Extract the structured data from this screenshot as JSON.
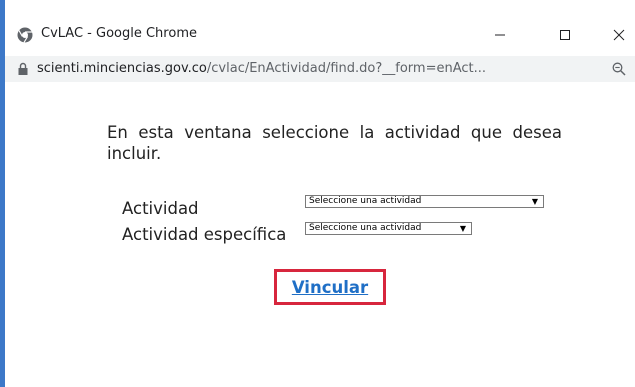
{
  "window": {
    "title": "CvLAC - Google Chrome",
    "minimize_label": "—",
    "maximize_label": "☐",
    "close_label": "✕",
    "accent_color": "#3c78c8"
  },
  "address": {
    "host": "scienti.minciencias.gov.co",
    "path": "/cvlac/EnActividad/find.do?__form=enAct..."
  },
  "page": {
    "intro_text": "En esta ventana seleccione la actividad que desea incluir.",
    "actividad_label": "Actividad",
    "actividad_select_value": "Seleccione una actividad",
    "especifica_label": "Actividad específica",
    "especifica_select_value": "Seleccione una actividad",
    "vincular_link": "Vincular",
    "highlight_color": "#d7263d",
    "link_color": "#1f6fc6"
  }
}
